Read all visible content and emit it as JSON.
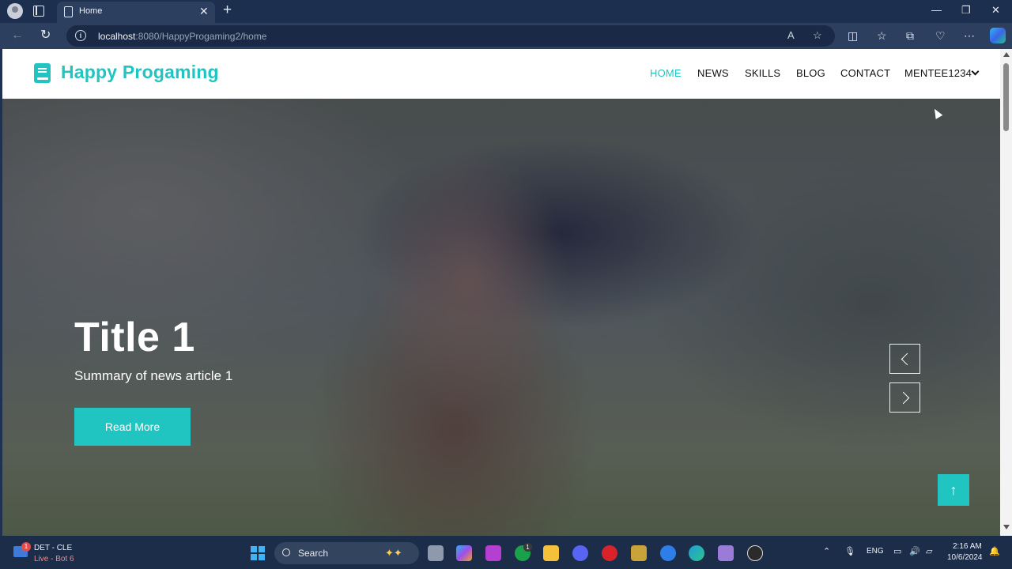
{
  "browser": {
    "tab_title": "Home",
    "url_host": "localhost",
    "url_rest": ":8080/HappyProgaming2/home"
  },
  "site": {
    "logo_text": "Happy Progaming",
    "nav": [
      "HOME",
      "NEWS",
      "SKILLS",
      "BLOG",
      "CONTACT",
      "MENTEE1234"
    ],
    "active_nav": "HOME",
    "accent_color": "#20c5c2"
  },
  "hero": {
    "title": "Title 1",
    "summary": "Summary of news article 1",
    "button_label": "Read More"
  },
  "taskbar": {
    "widget_title": "DET - CLE",
    "widget_sub": "Live - Bot 6",
    "widget_badge": "1",
    "search_label": "Search",
    "xbox_badge": "1",
    "lang": "ENG",
    "time": "2:16 AM",
    "date": "10/6/2024"
  }
}
